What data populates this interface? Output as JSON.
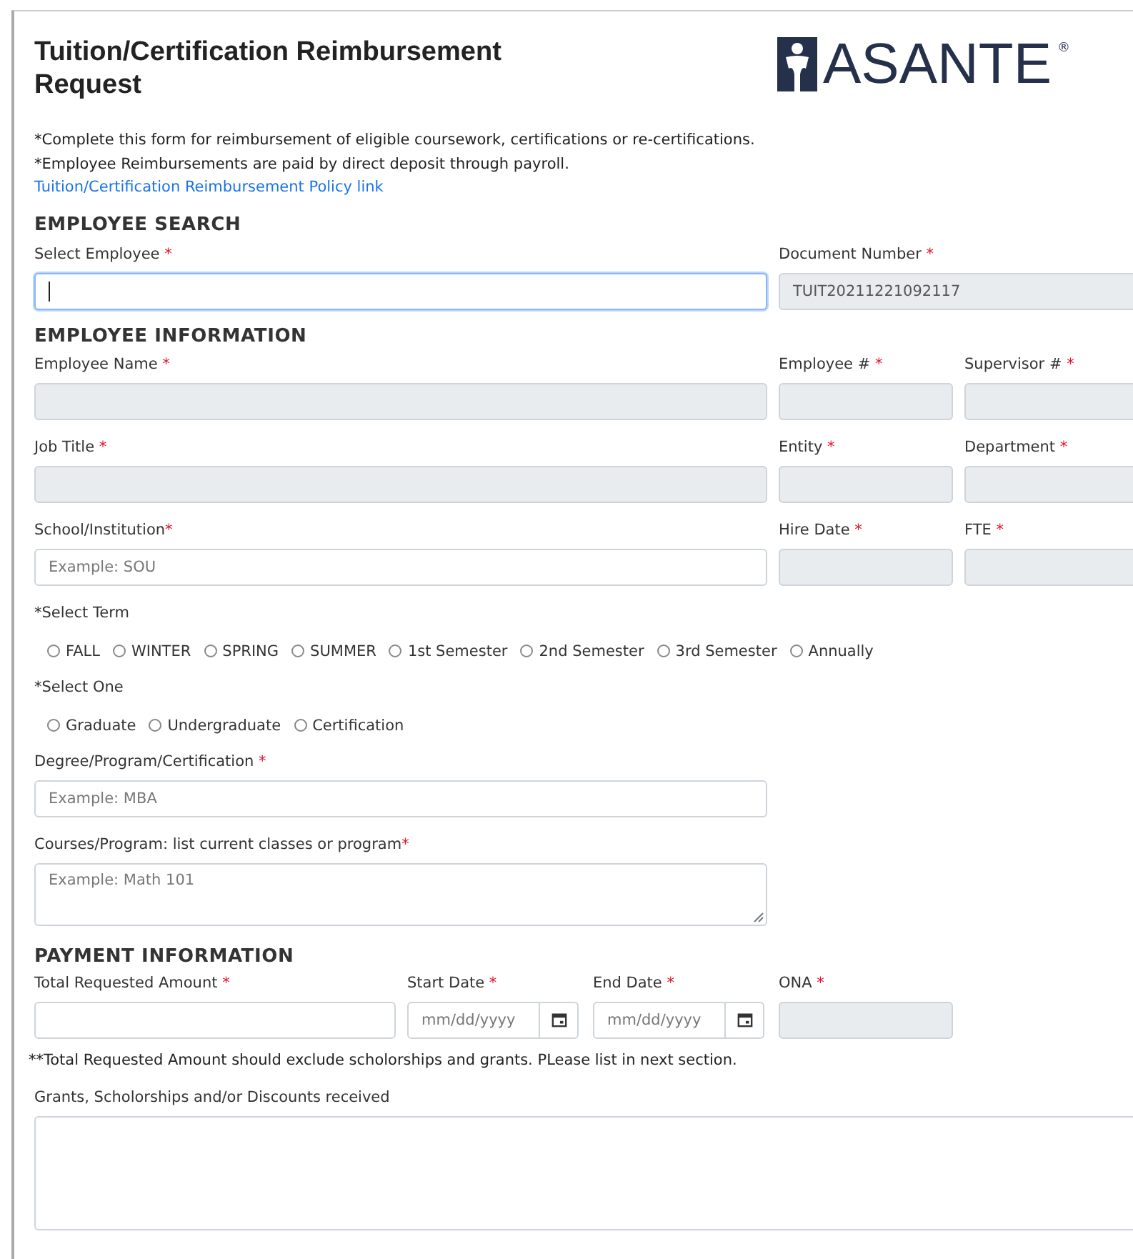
{
  "title": "Tuition/Certification Reimbursement Request",
  "logo": {
    "text": "ASANTE",
    "mark": "®"
  },
  "intro": [
    "*Complete this form for reimbursement of eligible coursework, certifications or re-certifications.",
    "*Employee Reimbursements are paid by direct deposit through payroll."
  ],
  "policy_link": "Tuition/Certification Reimbursement Policy link",
  "employee_search": {
    "heading": "EMPLOYEE SEARCH",
    "fields": [
      {
        "label": "Select Employee ",
        "mark": "*",
        "disabled": false,
        "focused": true
      },
      {
        "label": "Document Number ",
        "mark": "*",
        "disabled": true,
        "focused": false,
        "value": "TUIT20211221092117"
      }
    ]
  },
  "employee_information": {
    "heading": "EMPLOYEE INFORMATION",
    "rows": [
      [
        {
          "label": "Employee Name ",
          "mark": "*",
          "disabled": true
        },
        {
          "label": "Employee # ",
          "mark": "*",
          "disabled": true
        },
        {
          "label": "Supervisor # ",
          "mark": "*",
          "disabled": true
        }
      ],
      [
        {
          "label": "Job Title ",
          "mark": "*",
          "disabled": true
        },
        {
          "label": "Entity ",
          "mark": "*",
          "disabled": true
        },
        {
          "label": "Department ",
          "mark": "*",
          "disabled": true
        }
      ],
      [
        {
          "label": "School/Institution",
          "mark": "*",
          "disabled": false,
          "placeholder": "Example: SOU"
        },
        {
          "label": "Hire Date ",
          "mark": "*",
          "disabled": true
        },
        {
          "label": "FTE ",
          "mark": "*",
          "disabled": true
        }
      ]
    ],
    "term": {
      "label": "*Select Term",
      "options": [
        {
          "label": "FALL",
          "selected": false
        },
        {
          "label": "WINTER",
          "selected": false
        },
        {
          "label": "SPRING",
          "selected": false
        },
        {
          "label": "SUMMER",
          "selected": false
        },
        {
          "label": "1st Semester",
          "selected": false
        },
        {
          "label": "2nd Semester",
          "selected": false
        },
        {
          "label": "3rd Semester",
          "selected": false
        },
        {
          "label": "Annually",
          "selected": false
        }
      ]
    },
    "select_one": {
      "label": "*Select One",
      "options": [
        {
          "label": "Graduate",
          "selected": false
        },
        {
          "label": "Undergraduate",
          "selected": false
        },
        {
          "label": "Certification",
          "selected": false
        }
      ]
    },
    "degree": {
      "label": "Degree/Program/Certification ",
      "mark": "*",
      "placeholder": "Example: MBA"
    },
    "courses": {
      "label": "Courses/Program: list current classes or program",
      "mark": "*",
      "placeholder": "Example: Math 101"
    }
  },
  "payment_information": {
    "heading": "PAYMENT INFORMATION",
    "fields": [
      {
        "kind": "text",
        "label": "Total Requested Amount ",
        "mark": "*",
        "disabled": false
      },
      {
        "kind": "date",
        "label": "Start Date ",
        "mark": "*",
        "disabled": false,
        "placeholder": "mm/dd/yyyy"
      },
      {
        "kind": "date",
        "label": "End Date ",
        "mark": "*",
        "disabled": false,
        "placeholder": "mm/dd/yyyy"
      },
      {
        "kind": "text",
        "label": "ONA ",
        "mark": "*",
        "disabled": true
      }
    ],
    "note": "**Total Requested Amount should exclude scholorships and grants. PLease list in next section.",
    "grants": {
      "label": "Grants, Scholorships and/or Discounts received"
    }
  }
}
